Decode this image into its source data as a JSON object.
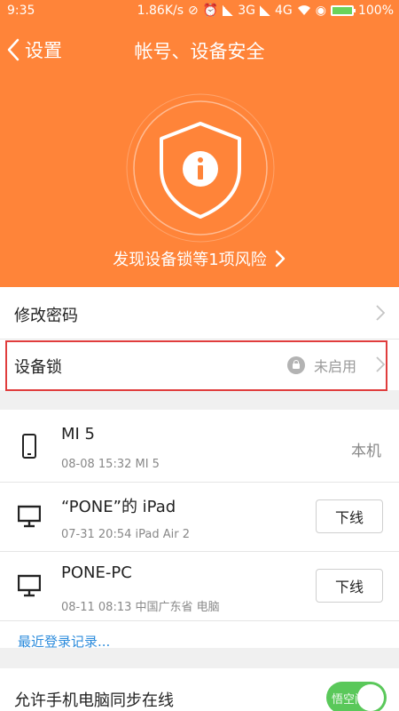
{
  "status_bar": {
    "time": "9:35",
    "speed": "1.86K/s",
    "network": "3G",
    "network2": "4G",
    "battery": "100%"
  },
  "header": {
    "back_label": "设置",
    "title": "帐号、设备安全",
    "risk_text": "发现设备锁等1项风险",
    "accent_color": "#ff8439"
  },
  "settings": [
    {
      "label": "修改密码"
    },
    {
      "label": "设备锁",
      "status": "未启用"
    }
  ],
  "devices": [
    {
      "name": "MI 5",
      "detail": "08-08 15:32 MI 5",
      "tag": "本机",
      "icon": "phone-icon"
    },
    {
      "name": "“PONE”的 iPad",
      "detail": "07-31 20:54 iPad Air 2",
      "action": "下线",
      "icon": "monitor-icon"
    },
    {
      "name": "PONE-PC",
      "detail": "08-11 08:13 中国广东省 电脑",
      "action": "下线",
      "icon": "monitor-icon"
    }
  ],
  "recent_login": "最近登录记录...",
  "sync": {
    "label": "允许手机电脑同步在线",
    "enabled": true,
    "toggle_color": "#5ac85a"
  },
  "watermark": "悟空问答"
}
